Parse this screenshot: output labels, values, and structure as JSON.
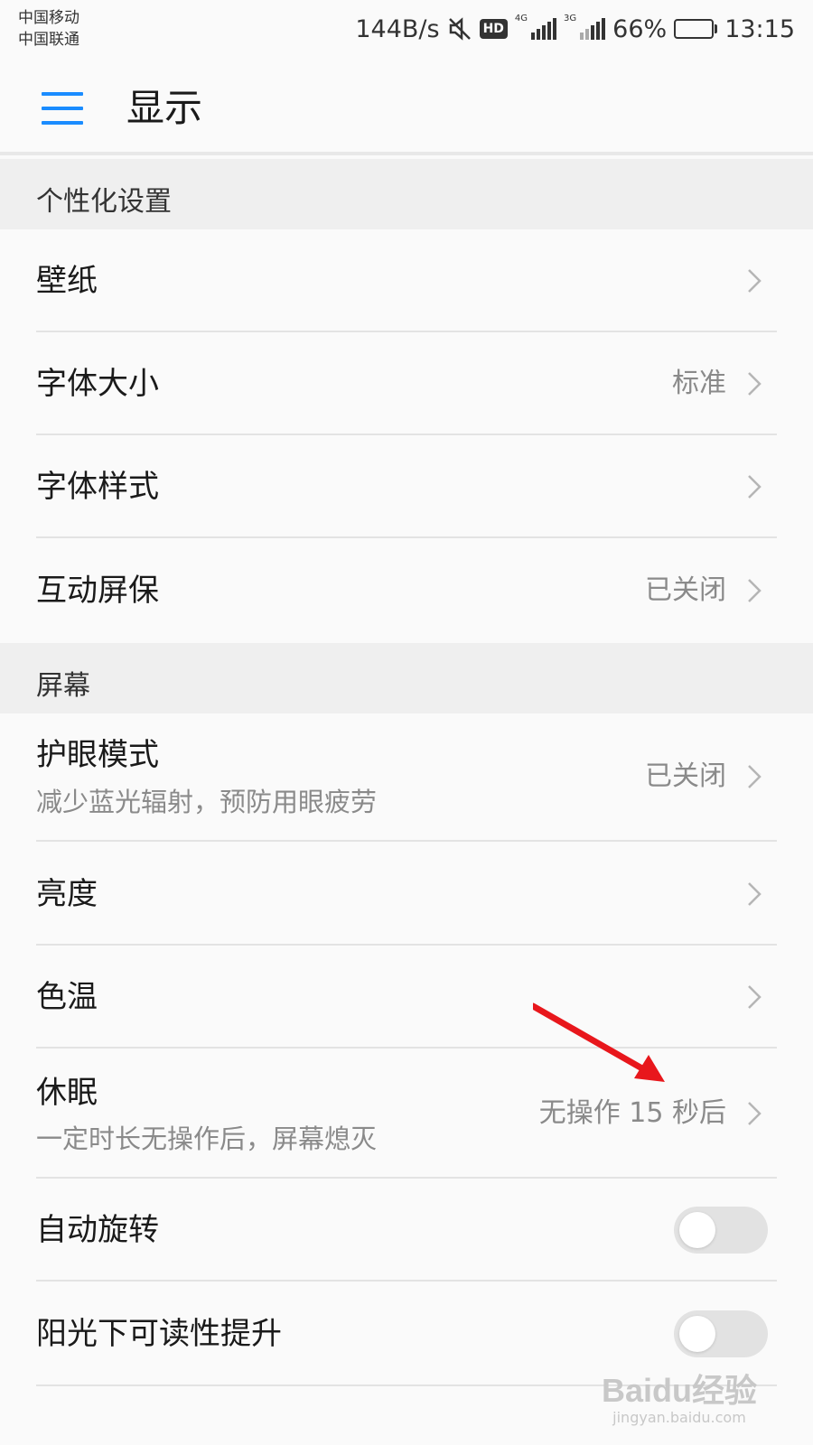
{
  "status_bar": {
    "carrier_1": "中国移动",
    "carrier_2": "中国联通",
    "net_speed": "144B/s",
    "hd": "HD",
    "net_1": "4G",
    "net_2": "3G",
    "battery_pct": "66%",
    "battery_level": 0.66,
    "time": "13:15",
    "icons": [
      "mute-icon",
      "signal-icon",
      "battery-icon"
    ]
  },
  "app_bar": {
    "title": "显示",
    "menu_icon": "hamburger-menu-icon",
    "accent_color": "#1a8cff"
  },
  "sections": [
    {
      "header": "个性化设置",
      "items": [
        {
          "title": "壁纸",
          "value": ""
        },
        {
          "title": "字体大小",
          "value": "标准"
        },
        {
          "title": "字体样式",
          "value": ""
        },
        {
          "title": "互动屏保",
          "value": "已关闭"
        }
      ]
    },
    {
      "header": "屏幕",
      "items": [
        {
          "title": "护眼模式",
          "subtitle": "减少蓝光辐射，预防用眼疲劳",
          "value": "已关闭"
        },
        {
          "title": "亮度",
          "value": ""
        },
        {
          "title": "色温",
          "value": ""
        },
        {
          "title": "休眠",
          "subtitle": "一定时长无操作后，屏幕熄灭",
          "value": "无操作 15 秒后"
        },
        {
          "title": "自动旋转",
          "toggle": false
        },
        {
          "title": "阳光下可读性提升",
          "toggle": false
        }
      ]
    }
  ],
  "annotation": {
    "arrow_color": "#e8171c"
  },
  "watermark": {
    "logo": "Baidu经验",
    "url": "jingyan.baidu.com"
  }
}
